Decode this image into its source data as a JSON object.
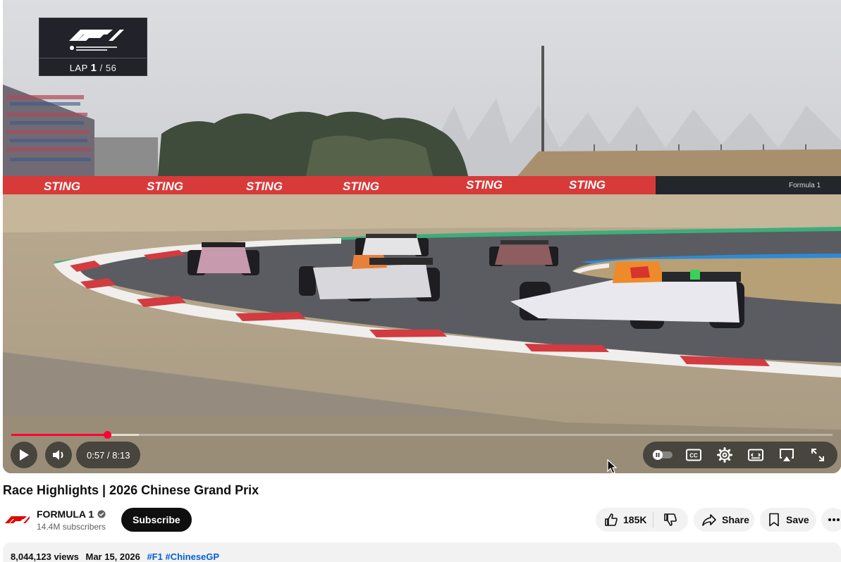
{
  "player": {
    "overlay": {
      "lap_label": "LAP",
      "lap_current": "1",
      "lap_total": "/ 56",
      "logo_caption": "FIA Formula 1 World Championship"
    },
    "ad_boards": [
      "STING",
      "STING",
      "STING",
      "STING",
      "STING",
      "STING"
    ],
    "ad_board_right": "Formula 1",
    "progress_fraction": 0.117,
    "buffer_fraction": 0.155,
    "time_display": "0:57 / 8:13",
    "controls": {
      "left": [
        "play-icon",
        "volume-icon"
      ],
      "right": [
        "autoplay-toggle-icon",
        "captions-icon",
        "settings-icon",
        "miniplayer-icon",
        "airplay-icon",
        "fullscreen-icon"
      ]
    },
    "colors": {
      "progress": "#ff0033",
      "pill_bg": "#282828"
    }
  },
  "video": {
    "title": "Race Highlights | 2026 Chinese Grand Prix"
  },
  "channel": {
    "name": "FORMULA 1",
    "subscribers": "14.4M subscribers",
    "subscribe_label": "Subscribe",
    "verified": "verified-badge-icon"
  },
  "actions": {
    "like_count": "185K",
    "share_label": "Share",
    "save_label": "Save"
  },
  "description": {
    "views": "8,044,123 views",
    "date": "Mar 15, 2026",
    "hashtags": [
      "#F1",
      "#ChineseGP"
    ]
  },
  "colors": {
    "brand_red": "#e10600",
    "link_blue": "#065fd4",
    "button_dark": "#0f0f0f",
    "chip_bg": "#f2f2f2"
  }
}
